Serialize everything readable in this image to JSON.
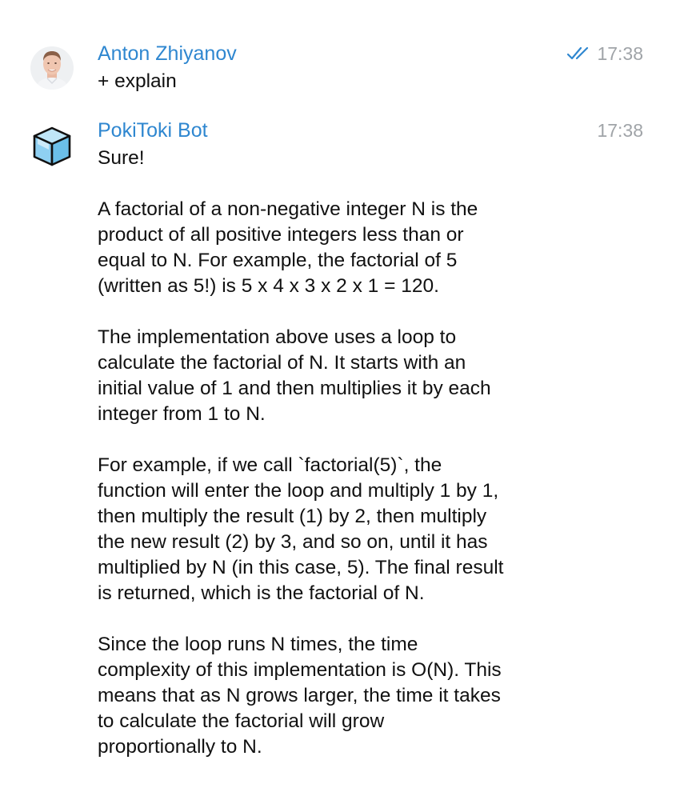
{
  "messages": [
    {
      "sender": "Anton Zhiyanov",
      "time": "17:38",
      "read_status_icon": "double-check-icon",
      "avatar_icon": "user-photo-avatar",
      "text": "+ explain"
    },
    {
      "sender": "PokiToki Bot",
      "time": "17:38",
      "avatar_icon": "cube-icon",
      "paragraphs": [
        "Sure!",
        "A factorial of a non-negative integer N is the\nproduct of all positive integers less than or\nequal to N. For example, the factorial of 5\n(written as 5!) is 5 x 4 x 3 x 2 x 1 = 120.",
        "The implementation above uses a loop to\ncalculate the factorial of N. It starts with an\ninitial value of 1 and then multiplies it by each\ninteger from 1 to N.",
        "For example, if we call `factorial(5)`, the\nfunction will enter the loop and multiply 1 by 1,\nthen multiply the result (1) by 2, then multiply\nthe new result (2) by 3, and so on, until it has\nmultiplied by N (in this case, 5). The final result\nis returned, which is the factorial of N.",
        "Since the loop runs N times, the time\ncomplexity of this implementation is O(N). This\nmeans that as N grows larger, the time it takes\nto calculate the factorial will grow\nproportionally to N."
      ]
    }
  ],
  "colors": {
    "sender_name": "#2f87d0",
    "timestamp": "#a0a4a8",
    "read_check": "#2f87d0",
    "cube_top": "#bfe6f8",
    "cube_left": "#8fd0f2",
    "cube_right": "#6bbfe9"
  }
}
